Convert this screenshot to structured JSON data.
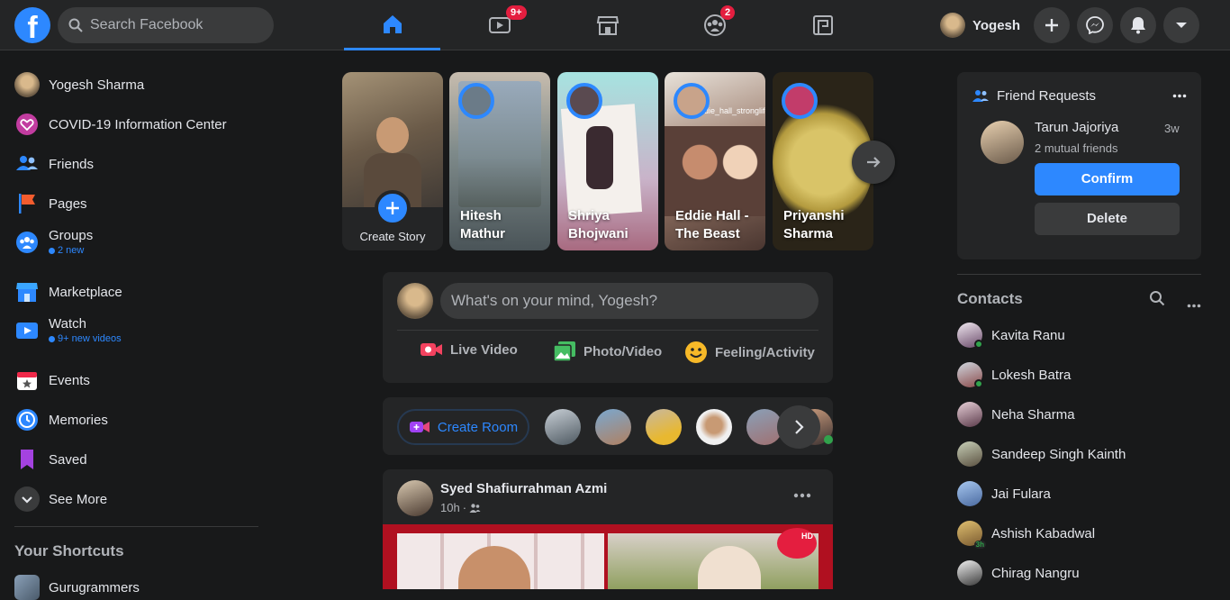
{
  "search": {
    "placeholder": "Search Facebook"
  },
  "nav": {
    "badges": {
      "watch": "9+",
      "groups": "2"
    }
  },
  "header": {
    "user_name": "Yogesh"
  },
  "sidebar": {
    "items": [
      {
        "label": "Yogesh Sharma"
      },
      {
        "label": "COVID-19 Information Center"
      },
      {
        "label": "Friends"
      },
      {
        "label": "Pages"
      },
      {
        "label": "Groups",
        "sub": "2 new"
      },
      {
        "label": "Marketplace"
      },
      {
        "label": "Watch",
        "sub": "9+ new videos"
      },
      {
        "label": "Events"
      },
      {
        "label": "Memories"
      },
      {
        "label": "Saved"
      },
      {
        "label": "See More"
      }
    ],
    "shortcuts_title": "Your Shortcuts",
    "shortcuts": [
      {
        "label": "Gurugrammers"
      }
    ]
  },
  "stories": {
    "create_label": "Create Story",
    "items": [
      {
        "name_line1": "Hitesh",
        "name_line2": "Mathur"
      },
      {
        "name_line1": "Shriya",
        "name_line2": "Bhojwani"
      },
      {
        "name_line1": "Eddie Hall -",
        "name_line2": "The Beast",
        "overlay": "eddie_hall_stronglife"
      },
      {
        "name_line1": "Priyanshi",
        "name_line2": "Sharma"
      }
    ]
  },
  "composer": {
    "placeholder": "What's on your mind, Yogesh?",
    "live_label": "Live Video",
    "photo_label": "Photo/Video",
    "feeling_label": "Feeling/Activity"
  },
  "rooms": {
    "create_label": "Create Room"
  },
  "post": {
    "author": "Syed Shafiurrahman Azmi",
    "time": "10h",
    "privacy_sep": "·",
    "image_logo": "HD"
  },
  "friend_requests": {
    "title": "Friend Requests",
    "name": "Tarun Jajoriya",
    "time": "3w",
    "mutual": "2 mutual friends",
    "confirm_label": "Confirm",
    "delete_label": "Delete"
  },
  "contacts": {
    "title": "Contacts",
    "items": [
      {
        "name": "Kavita Ranu",
        "online": true
      },
      {
        "name": "Lokesh Batra",
        "online": true
      },
      {
        "name": "Neha Sharma",
        "online": false
      },
      {
        "name": "Sandeep Singh Kainth",
        "online": false
      },
      {
        "name": "Jai Fulara",
        "online": false
      },
      {
        "name": "Ashish Kabadwal",
        "online": false,
        "idle": "3h"
      },
      {
        "name": "Chirag Nangru",
        "online": false
      }
    ]
  },
  "colors": {
    "accent": "#2d88ff",
    "badge": "#e41e3f",
    "online": "#31a24c",
    "bg": "#18191a",
    "surface": "#242526"
  }
}
